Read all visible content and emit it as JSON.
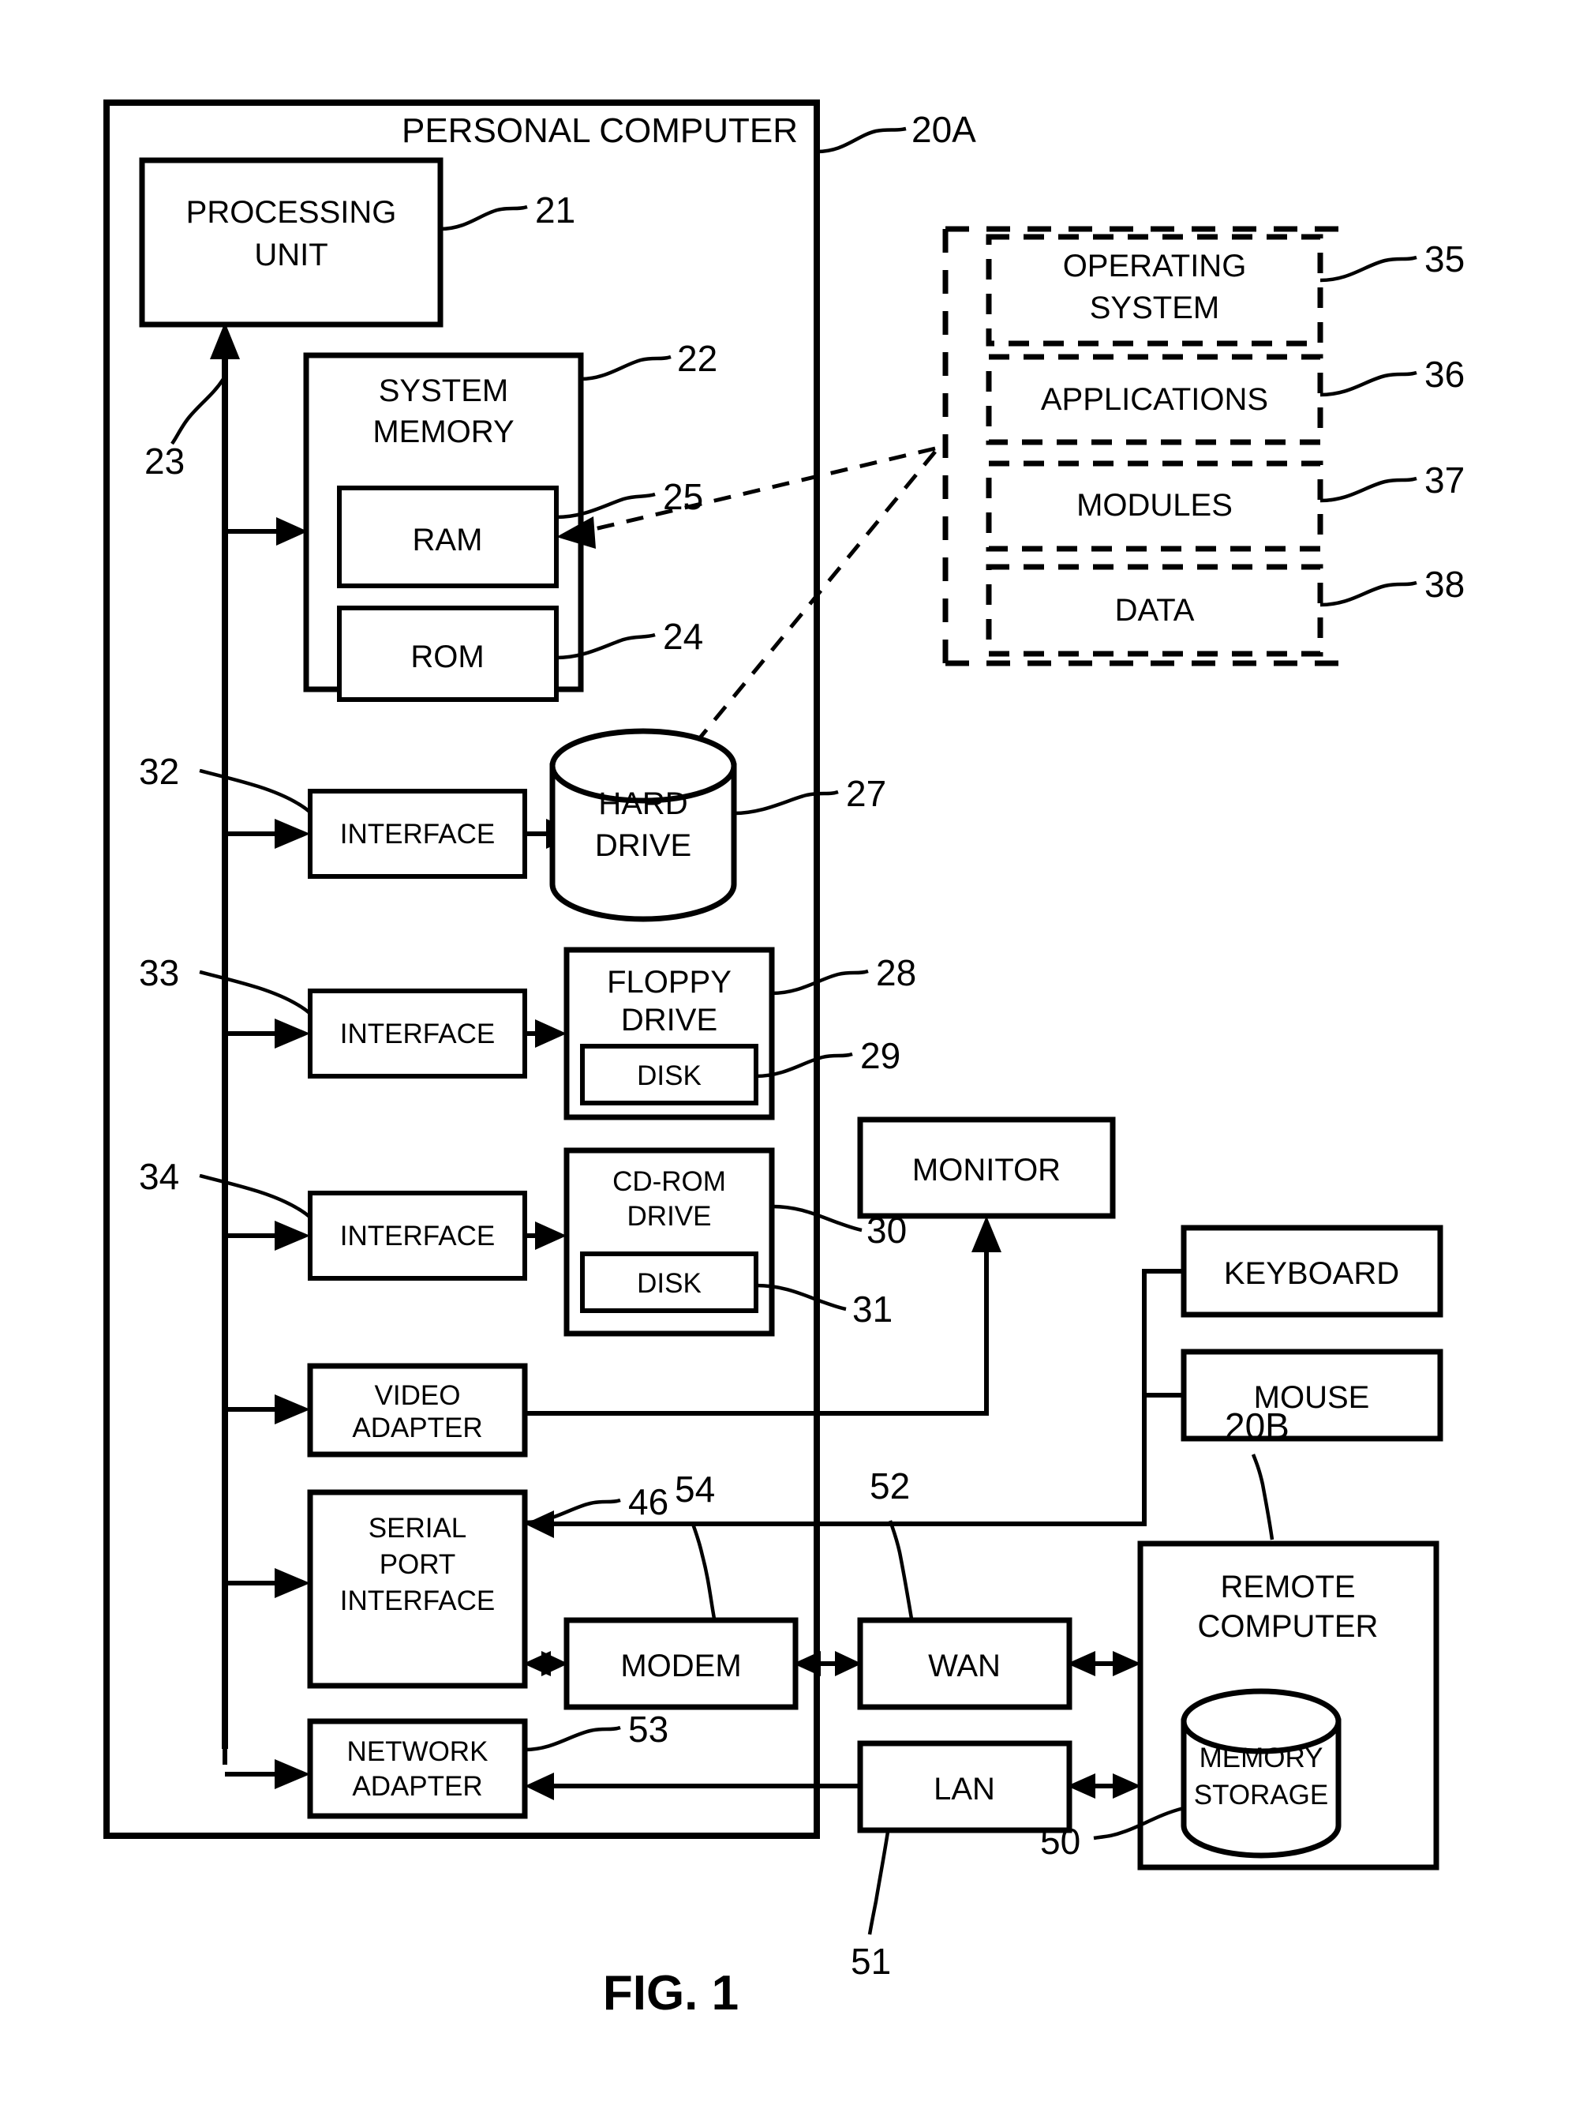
{
  "figure": {
    "caption": "FIG. 1",
    "outer_label": "PERSONAL COMPUTER",
    "outer_ref": "20A"
  },
  "blocks": {
    "processing_unit": {
      "line1": "PROCESSING",
      "line2": "UNIT",
      "ref": "21"
    },
    "bus": {
      "ref": "23"
    },
    "system_memory": {
      "line1": "SYSTEM",
      "line2": "MEMORY",
      "ref": "22"
    },
    "ram": {
      "label": "RAM",
      "ref": "25"
    },
    "rom": {
      "label": "ROM",
      "ref": "24"
    },
    "interface_hdd": {
      "label": "INTERFACE",
      "ref": "32"
    },
    "hard_drive": {
      "line1": "HARD",
      "line2": "DRIVE",
      "ref": "27"
    },
    "interface_floppy": {
      "label": "INTERFACE",
      "ref": "33"
    },
    "floppy_drive": {
      "line1": "FLOPPY",
      "line2": "DRIVE",
      "ref": "28"
    },
    "floppy_disk": {
      "label": "DISK",
      "ref": "29"
    },
    "interface_cdrom": {
      "label": "INTERFACE",
      "ref": "34"
    },
    "cdrom_drive": {
      "line1": "CD-ROM",
      "line2": "DRIVE",
      "ref": "30"
    },
    "cdrom_disk": {
      "label": "DISK",
      "ref": "31"
    },
    "monitor": {
      "label": "MONITOR"
    },
    "video_adapter": {
      "line1": "VIDEO",
      "line2": "ADAPTER"
    },
    "serial_port_interface": {
      "line1": "SERIAL",
      "line2": "PORT",
      "line3": "INTERFACE",
      "ref": "46"
    },
    "modem": {
      "label": "MODEM",
      "ref": "54"
    },
    "wan": {
      "label": "WAN",
      "ref": "52"
    },
    "network_adapter": {
      "line1": "NETWORK",
      "line2": "ADAPTER",
      "ref": "53"
    },
    "lan": {
      "label": "LAN",
      "ref": "51"
    },
    "keyboard": {
      "label": "KEYBOARD"
    },
    "mouse": {
      "label": "MOUSE"
    },
    "remote_computer": {
      "line1": "REMOTE",
      "line2": "COMPUTER",
      "ref": "20B"
    },
    "memory_storage": {
      "line1": "MEMORY",
      "line2": "STORAGE",
      "ref": "50"
    }
  },
  "software_container": {
    "items": [
      {
        "line1": "OPERATING",
        "line2": "SYSTEM",
        "ref": "35"
      },
      {
        "line1": "APPLICATIONS",
        "line2": "",
        "ref": "36"
      },
      {
        "line1": "MODULES",
        "line2": "",
        "ref": "37"
      },
      {
        "line1": "DATA",
        "line2": "",
        "ref": "38"
      }
    ]
  },
  "colors": {
    "ink": "#000000",
    "paper": "#ffffff"
  }
}
